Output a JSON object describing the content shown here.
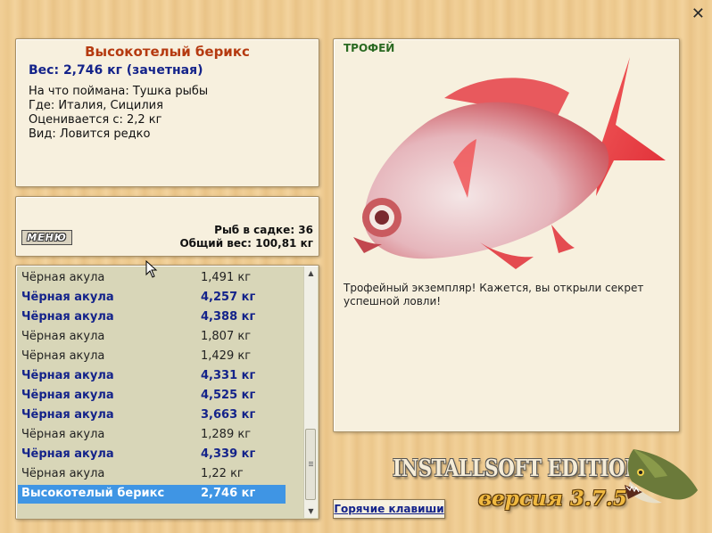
{
  "fish": {
    "name": "Высокотелый берикс",
    "weight_line": "Вес: 2,746 кг (зачетная)",
    "bait": "На что поймана: Тушка рыбы",
    "location": "Где: Италия, Сицилия",
    "rated_from": "Оценивается с: 2,2 кг",
    "kind": "Вид: Ловится редко"
  },
  "stats": {
    "menu_label": "МЕНЮ",
    "fish_in_keepnet": "Рыб в садке: 36",
    "total_weight": "Общий вес: 100,81 кг"
  },
  "catch_list": [
    {
      "name": "Чёрная акула",
      "weight": "1,491 кг",
      "style": "normal"
    },
    {
      "name": "Чёрная акула",
      "weight": "4,257 кг",
      "style": "bold"
    },
    {
      "name": "Чёрная акула",
      "weight": "4,388 кг",
      "style": "bold"
    },
    {
      "name": "Чёрная акула",
      "weight": "1,807 кг",
      "style": "normal"
    },
    {
      "name": "Чёрная акула",
      "weight": "1,429 кг",
      "style": "normal"
    },
    {
      "name": "Чёрная акула",
      "weight": "4,331 кг",
      "style": "bold"
    },
    {
      "name": "Чёрная акула",
      "weight": "4,525 кг",
      "style": "bold"
    },
    {
      "name": "Чёрная акула",
      "weight": "3,663 кг",
      "style": "bold"
    },
    {
      "name": "Чёрная акула",
      "weight": "1,289 кг",
      "style": "normal"
    },
    {
      "name": "Чёрная акула",
      "weight": "4,339 кг",
      "style": "bold"
    },
    {
      "name": "Чёрная акула",
      "weight": "1,22 кг",
      "style": "normal"
    },
    {
      "name": "Высокотелый берикс",
      "weight": "2,746 кг",
      "style": "selected"
    }
  ],
  "trophy": {
    "label": "ТРОФЕЙ",
    "message": "Трофейный экземпляр! Кажется, вы открыли секрет успешной ловли!"
  },
  "hotkeys_label": "Горячие клавиши",
  "brand": "INSTALLSOFT EDITION",
  "version": "версия 3.7.5",
  "icons": {
    "close": "close-icon",
    "scroll_up": "chevron-up-icon",
    "scroll_down": "chevron-down-icon",
    "fish_picture": "fish-image",
    "pike_logo": "pike-icon",
    "cursor": "cursor-icon"
  },
  "colors": {
    "title": "#b53a10",
    "accent_blue": "#14238a",
    "selection": "#3f95e4",
    "trophy_label": "#2b6a22"
  }
}
